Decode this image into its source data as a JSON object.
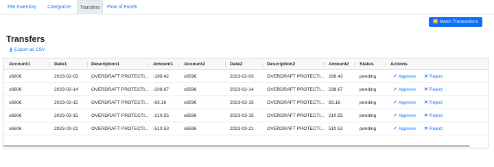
{
  "tabs": [
    "File Inventory",
    "Categorize",
    "Transfers",
    "Flow of Funds"
  ],
  "active_tab": "Transfers",
  "match_button": {
    "icon": "fast-forward-icon",
    "label": "Match Transactions"
  },
  "page_title": "Transfers",
  "export": {
    "icon": "download-icon",
    "label": "Export as CSV"
  },
  "table": {
    "columns": [
      "Account1",
      "Date1",
      "Description1",
      "Amount1",
      "Account2",
      "Date2",
      "Description2",
      "Amount2",
      "Status",
      "Actions"
    ],
    "rows": [
      [
        "x6606",
        "2023-02-03",
        "OVERDRAFT PROTECTI...",
        "-199.42",
        "x6596",
        "2023-02-03",
        "OVERDRAFT PROTECTI...",
        "199.42",
        "pending"
      ],
      [
        "x6606",
        "2023-02-14",
        "OVERDRAFT PROTECTI...",
        "-238.67",
        "x6596",
        "2023-02-14",
        "OVERDRAFT PROTECTI...",
        "238.67",
        "pending"
      ],
      [
        "x6606",
        "2023-02-15",
        "OVERDRAFT PROTECTI...",
        "-83.16",
        "x6596",
        "2023-02-15",
        "OVERDRAFT PROTECTI...",
        "83.16",
        "pending"
      ],
      [
        "x6606",
        "2023-03-15",
        "OVERDRAFT PROTECTI...",
        "-210.55",
        "x6596",
        "2023-03-15",
        "OVERDRAFT PROTECTI...",
        "210.55",
        "pending"
      ],
      [
        "x6606",
        "2023-03-21",
        "OVERDRAFT PROTECTI...",
        "-510.53",
        "x6596",
        "2023-03-21",
        "OVERDRAFT PROTECTI...",
        "510.53",
        "pending"
      ]
    ],
    "actions": {
      "approve_label": "Approve",
      "approve_icon": "check-icon",
      "reject_label": "Reject",
      "reject_icon": "x-icon"
    }
  },
  "colors": {
    "accent": "#0d6efd",
    "header_bg": "#f8f8f8",
    "border": "#d5d8dc"
  }
}
